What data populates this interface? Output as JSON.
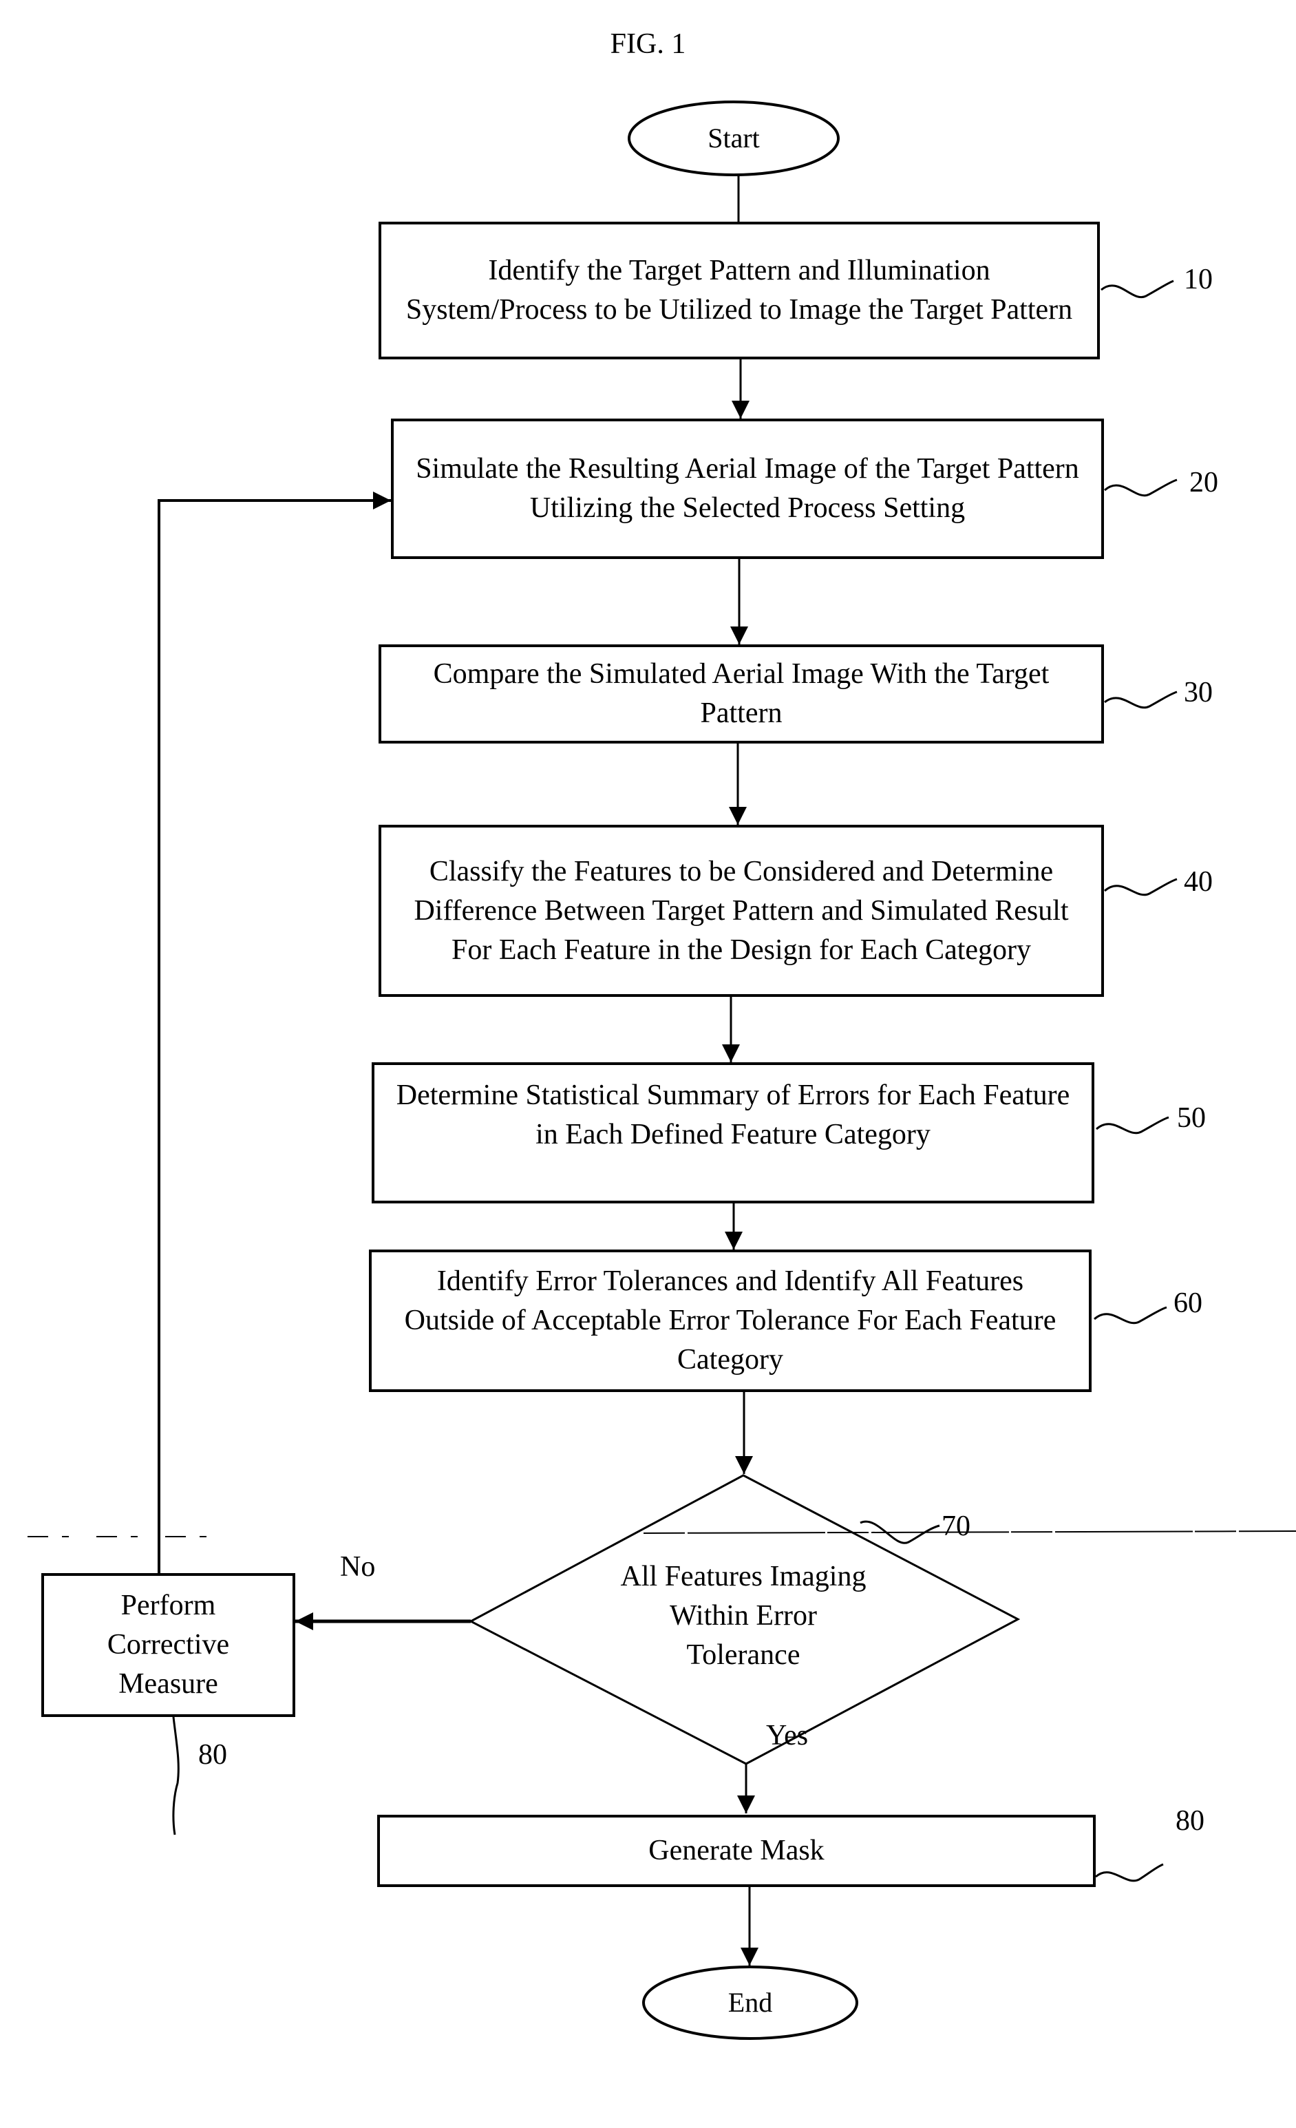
{
  "figure": {
    "title": "FIG. 1",
    "start_label": "Start",
    "end_label": "End"
  },
  "steps": [
    {
      "ref": "10",
      "text": "Identify the Target Pattern and Illumination System/Process to be Utilized to Image the Target Pattern"
    },
    {
      "ref": "20",
      "text": "Simulate the Resulting Aerial Image of the Target Pattern Utilizing the Selected Process Setting"
    },
    {
      "ref": "30",
      "text": "Compare the Simulated Aerial Image With the Target Pattern"
    },
    {
      "ref": "40",
      "text": "Classify the Features to be Considered and Determine Difference Between Target Pattern and Simulated Result For Each Feature in the Design for Each Category"
    },
    {
      "ref": "50",
      "text": "Determine Statistical Summary of Errors for Each Feature in Each Defined Feature Category"
    },
    {
      "ref": "60",
      "text": "Identify Error Tolerances and Identify All Features Outside of Acceptable Error Tolerance For Each Feature Category"
    }
  ],
  "decision": {
    "ref": "70",
    "text": "All Features Imaging Within Error Tolerance",
    "no_label": "No",
    "yes_label": "Yes"
  },
  "corrective": {
    "ref": "80",
    "text": "Perform Corrective Measure"
  },
  "generate": {
    "ref": "80",
    "text": "Generate Mask"
  }
}
